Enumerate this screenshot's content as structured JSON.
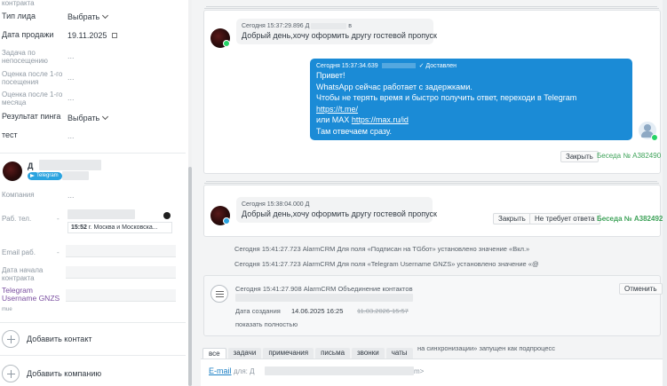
{
  "left_panel": {
    "top_cut_label": "контракта",
    "lead_type": {
      "label": "Тип лида",
      "value": "Выбрать"
    },
    "sale_date": {
      "label": "Дата продажи",
      "value": "19.11.2025"
    },
    "task_no_visit": {
      "label": "Задача по непосещению",
      "value": "..."
    },
    "rating_after_first_visit": {
      "label": "Оценка после 1-го посещения",
      "value": "..."
    },
    "rating_after_first_month": {
      "label": "Оценка после 1-го месяца",
      "value": "..."
    },
    "ping_result": {
      "label": "Результат пинга",
      "value": "Выбрать"
    },
    "test": {
      "label": "тест",
      "value": "..."
    },
    "contact": {
      "name": "Д",
      "badge": "Telegram",
      "company": {
        "label": "Компания",
        "value": "..."
      },
      "work_phone": {
        "label": "Раб. тел.",
        "region_time": "15:52",
        "region": "г. Москва и Московска..."
      },
      "work_email": {
        "label": "Email раб."
      },
      "contract_start": {
        "label": "Дата начала контракта"
      },
      "telegram_username": {
        "label": "Telegram Username GNZS",
        "sub": "mue"
      }
    },
    "add_contact": "Добавить контакт",
    "add_company": "Добавить компанию"
  },
  "feed": {
    "msg1": {
      "meta": "Сегодня 15:37:29.896 Д",
      "meta_suffix": "в",
      "text": "Добрый день,хочу оформить другу гостевой пропуск"
    },
    "msg2": {
      "meta": "Сегодня 15:37:34.639",
      "status": "Доставлен",
      "lines": [
        "Привет!",
        "WhatsApp сейчас работает с задержками.",
        "Чтобы не терять время и быстро получить ответ, переходи в Telegram"
      ],
      "link1": "https://t.me/",
      "line_max_prefix": "или MAX ",
      "link2": "https://max.ru/id",
      "last_line": "Там отвечаем сразу."
    },
    "card1_actions": {
      "close": "Закрыть",
      "conversation": "Беседа № А382490"
    },
    "msg3": {
      "meta": "Сегодня 15:38:04.000 Д",
      "text": "Добрый день,хочу оформить другу гостевой пропуск"
    },
    "card2_actions": {
      "close": "Закрыть",
      "no_reply": "Не требует ответа",
      "conversation": "Беседа № А382492"
    },
    "system1": "Сегодня 15:41:27.723 AlarmCRM Для поля «Подписан на TGбот» установлено значение «Вкл.»",
    "system2": "Сегодня 15:41:27.723 AlarmCRM Для поля «Telegram Username GNZS» установлено значение «@",
    "merge": {
      "meta": "Сегодня 15:41:27.908 AlarmCRM Объединение контактов",
      "cancel": "Отменить",
      "created_label": "Дата создания",
      "created_value": "14.06.2025 16:25",
      "created_old": "11.03.2026 15:57",
      "show_full": "показать полностью"
    },
    "partial_system": "на синхронизации» запущен как подпроцесс",
    "tabs": [
      "все",
      "задачи",
      "примечания",
      "письма",
      "звонки",
      "чаты"
    ],
    "compose": {
      "channel": "E-mail",
      "for_prefix": "для: Д",
      "suffix": "m>"
    }
  },
  "colors": {
    "accent_blue": "#1b8bd6",
    "telegram": "#2aa3df",
    "whatsapp": "#25d366",
    "green_link": "#3fa35a"
  }
}
